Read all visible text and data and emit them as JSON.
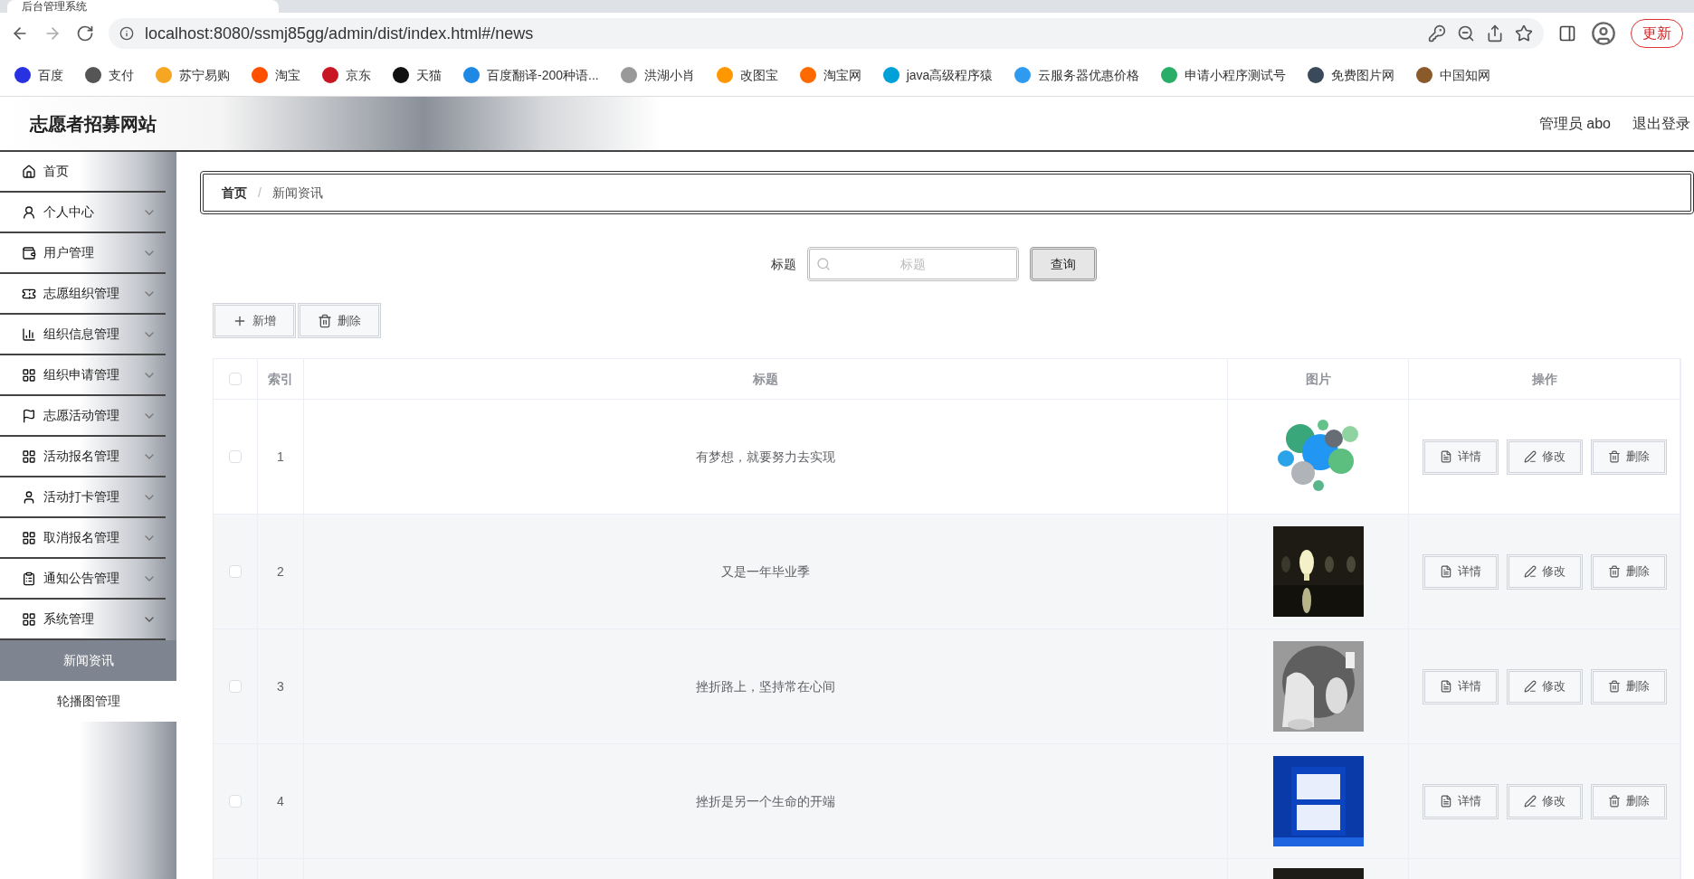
{
  "browser": {
    "tab_title": "后台管理系统",
    "url": "localhost:8080/ssmj85gg/admin/dist/index.html#/news",
    "update_button": "更新",
    "bookmarks": [
      {
        "label": "百度",
        "color": "#2932e1"
      },
      {
        "label": "支付",
        "color": "#555555"
      },
      {
        "label": "苏宁易购",
        "color": "#f5a623"
      },
      {
        "label": "淘宝",
        "color": "#ff5000"
      },
      {
        "label": "京东",
        "color": "#c91623"
      },
      {
        "label": "天猫",
        "color": "#111111"
      },
      {
        "label": "百度翻译-200种语...",
        "color": "#1e88e5"
      },
      {
        "label": "洪湖小肖",
        "color": "#999999"
      },
      {
        "label": "改图宝",
        "color": "#ff9800"
      },
      {
        "label": "淘宝网",
        "color": "#ff6a00"
      },
      {
        "label": "java高级程序猿",
        "color": "#00a1d6"
      },
      {
        "label": "云服务器优惠价格",
        "color": "#2f9bf0"
      },
      {
        "label": "申请小程序测试号",
        "color": "#2aae67"
      },
      {
        "label": "免费图片网",
        "color": "#3b4a5a"
      },
      {
        "label": "中国知网",
        "color": "#8b5a2b"
      }
    ]
  },
  "header": {
    "site_title": "志愿者招募网站",
    "user": "管理员 abo",
    "logout": "退出登录"
  },
  "sidebar": {
    "items": [
      {
        "label": "首页",
        "expandable": false
      },
      {
        "label": "个人中心",
        "expandable": true,
        "expanded": false
      },
      {
        "label": "用户管理",
        "expandable": true,
        "expanded": false
      },
      {
        "label": "志愿组织管理",
        "expandable": true,
        "expanded": false
      },
      {
        "label": "组织信息管理",
        "expandable": true,
        "expanded": false
      },
      {
        "label": "组织申请管理",
        "expandable": true,
        "expanded": false
      },
      {
        "label": "志愿活动管理",
        "expandable": true,
        "expanded": false
      },
      {
        "label": "活动报名管理",
        "expandable": true,
        "expanded": false
      },
      {
        "label": "活动打卡管理",
        "expandable": true,
        "expanded": false
      },
      {
        "label": "取消报名管理",
        "expandable": true,
        "expanded": false
      },
      {
        "label": "通知公告管理",
        "expandable": true,
        "expanded": false
      },
      {
        "label": "系统管理",
        "expandable": true,
        "expanded": true,
        "children": [
          {
            "label": "新闻资讯",
            "selected": true
          },
          {
            "label": "轮播图管理",
            "selected": false
          }
        ]
      }
    ]
  },
  "breadcrumb": {
    "separator": "/",
    "items": [
      "首页",
      "新闻资讯"
    ]
  },
  "search": {
    "label": "标题",
    "placeholder": "标题",
    "button": "查询"
  },
  "toolbar": {
    "add": "新增",
    "delete": "删除"
  },
  "table": {
    "select_all_checked": false,
    "columns": [
      "索引",
      "标题",
      "图片",
      "操作"
    ],
    "rows": [
      {
        "index": "1",
        "title": "有梦想，就要努力去实现",
        "checked": false,
        "image": {
          "kind": "picture"
        },
        "actions": [
          "详情",
          "修改",
          "删除"
        ]
      },
      {
        "index": "2",
        "title": "又是一年毕业季",
        "checked": false,
        "image": {
          "kind": "picture"
        },
        "actions": [
          "详情",
          "修改",
          "删除"
        ]
      },
      {
        "index": "3",
        "title": "挫折路上，坚持常在心间",
        "checked": false,
        "image": {
          "kind": "picture"
        },
        "actions": [
          "详情",
          "修改",
          "删除"
        ]
      },
      {
        "index": "4",
        "title": "挫折是另一个生命的开端",
        "checked": false,
        "image": {
          "kind": "picture"
        },
        "actions": [
          "详情",
          "修改",
          "删除"
        ]
      },
      {
        "image": {
          "kind": "picture"
        }
      }
    ]
  }
}
